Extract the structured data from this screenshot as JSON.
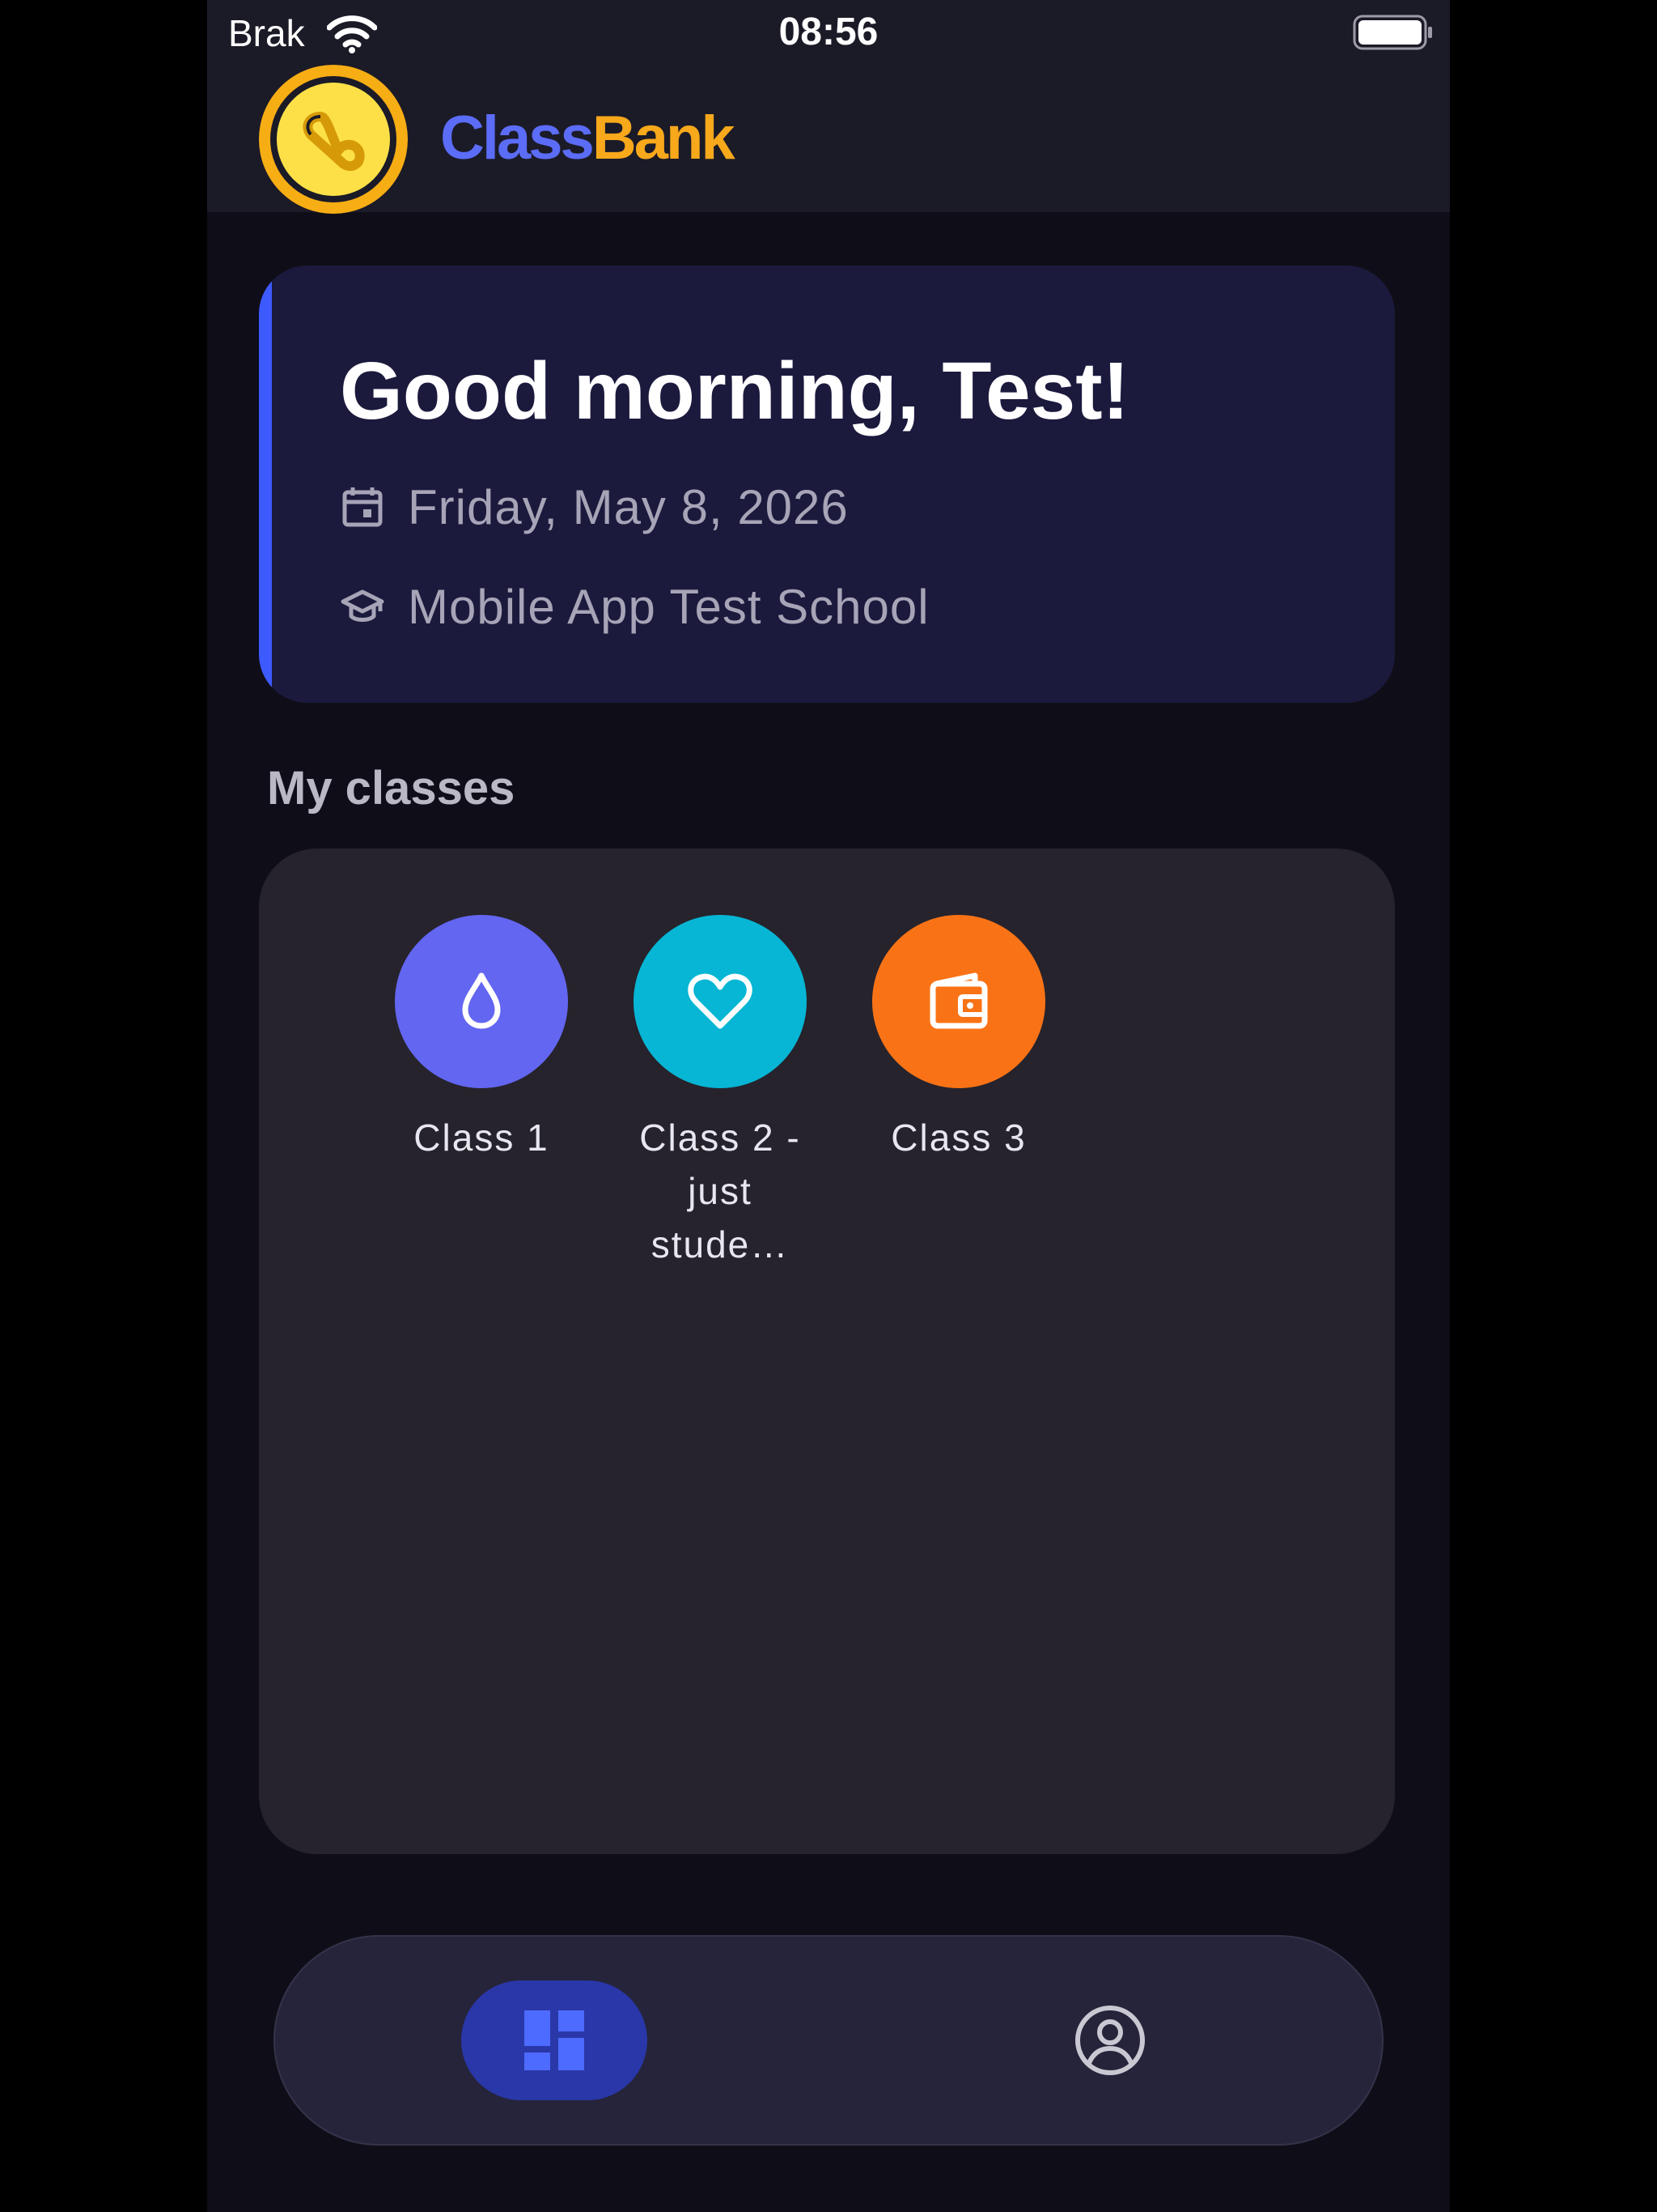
{
  "status_bar": {
    "carrier": "Brak",
    "time": "08:56",
    "wifi_icon": "wifi-icon",
    "battery_icon": "battery-full-icon"
  },
  "header": {
    "brand_part1": "Class",
    "brand_part2": "Bank",
    "logo_icon": "coin-logo-icon",
    "colors": {
      "brand_blue": "#5b6cf6",
      "brand_orange": "#f7a81b",
      "coin": "#fde047"
    }
  },
  "greeting": {
    "title": "Good morning, Test!",
    "date": "Friday, May 8, 2026",
    "school": "Mobile App Test School",
    "date_icon": "calendar-icon",
    "school_icon": "graduation-cap-icon",
    "accent_color": "#3d5afe"
  },
  "classes": {
    "section_title": "My classes",
    "items": [
      {
        "label": "Class 1",
        "icon": "drop-icon",
        "color": "#6366f1"
      },
      {
        "label": "Class 2 - just stude…",
        "icon": "heart-icon",
        "color": "#06b6d4"
      },
      {
        "label": "Class 3",
        "icon": "wallet-icon",
        "color": "#f97316"
      }
    ]
  },
  "nav": {
    "items": [
      {
        "icon": "dashboard-icon",
        "active": true
      },
      {
        "icon": "profile-icon",
        "active": false
      }
    ],
    "active_color": "#2a37a8"
  }
}
